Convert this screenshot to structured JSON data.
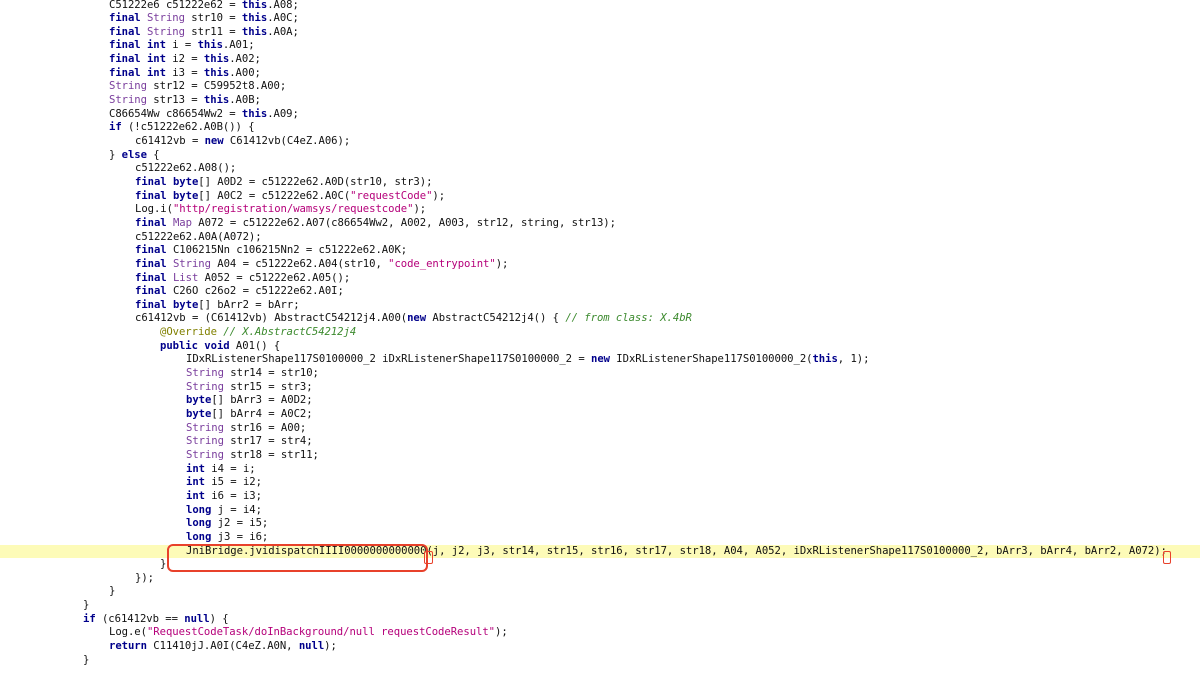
{
  "editor": {
    "highlight_color": "#fdfbb8",
    "annotation_color": "#e8412b",
    "token_colors": {
      "kw": "#00008b",
      "type": "#7a3e9d",
      "str": "#b5007a",
      "comment": "#3c8a2e",
      "annotation": "#808000"
    },
    "lines": [
      {
        "indent": 109,
        "tokens": [
          [
            "p",
            "C51222e6 c51222e62 = "
          ],
          [
            "k",
            "this"
          ],
          [
            "p",
            ".A08;"
          ]
        ]
      },
      {
        "indent": 109,
        "tokens": [
          [
            "k",
            "final "
          ],
          [
            "t",
            "String"
          ],
          [
            "p",
            " str10 = "
          ],
          [
            "k",
            "this"
          ],
          [
            "p",
            ".A0C;"
          ]
        ]
      },
      {
        "indent": 109,
        "tokens": [
          [
            "k",
            "final "
          ],
          [
            "t",
            "String"
          ],
          [
            "p",
            " str11 = "
          ],
          [
            "k",
            "this"
          ],
          [
            "p",
            ".A0A;"
          ]
        ]
      },
      {
        "indent": 109,
        "tokens": [
          [
            "k",
            "final int"
          ],
          [
            "p",
            " i = "
          ],
          [
            "k",
            "this"
          ],
          [
            "p",
            ".A01;"
          ]
        ]
      },
      {
        "indent": 109,
        "tokens": [
          [
            "k",
            "final int"
          ],
          [
            "p",
            " i2 = "
          ],
          [
            "k",
            "this"
          ],
          [
            "p",
            ".A02;"
          ]
        ]
      },
      {
        "indent": 109,
        "tokens": [
          [
            "k",
            "final int"
          ],
          [
            "p",
            " i3 = "
          ],
          [
            "k",
            "this"
          ],
          [
            "p",
            ".A00;"
          ]
        ]
      },
      {
        "indent": 109,
        "tokens": [
          [
            "t",
            "String"
          ],
          [
            "p",
            " str12 = C59952t8.A00;"
          ]
        ]
      },
      {
        "indent": 109,
        "tokens": [
          [
            "t",
            "String"
          ],
          [
            "p",
            " str13 = "
          ],
          [
            "k",
            "this"
          ],
          [
            "p",
            ".A0B;"
          ]
        ]
      },
      {
        "indent": 109,
        "tokens": [
          [
            "p",
            "C86654Ww c86654Ww2 = "
          ],
          [
            "k",
            "this"
          ],
          [
            "p",
            ".A09;"
          ]
        ]
      },
      {
        "indent": 109,
        "tokens": [
          [
            "k",
            "if"
          ],
          [
            "p",
            " (!c51222e62.A0B()) {"
          ]
        ]
      },
      {
        "indent": 135,
        "tokens": [
          [
            "p",
            "c61412vb = "
          ],
          [
            "k",
            "new"
          ],
          [
            "p",
            " C61412vb(C4eZ.A06);"
          ]
        ]
      },
      {
        "indent": 109,
        "tokens": [
          [
            "p",
            "} "
          ],
          [
            "k",
            "else"
          ],
          [
            "p",
            " {"
          ]
        ]
      },
      {
        "indent": 135,
        "tokens": [
          [
            "p",
            "c51222e62.A08();"
          ]
        ]
      },
      {
        "indent": 135,
        "tokens": [
          [
            "k",
            "final byte"
          ],
          [
            "p",
            "[] A0D2 = c51222e62.A0D(str10, str3);"
          ]
        ]
      },
      {
        "indent": 135,
        "tokens": [
          [
            "k",
            "final byte"
          ],
          [
            "p",
            "[] A0C2 = c51222e62.A0C("
          ],
          [
            "s",
            "\"requestCode\""
          ],
          [
            "p",
            ");"
          ]
        ]
      },
      {
        "indent": 135,
        "tokens": [
          [
            "p",
            "Log.i("
          ],
          [
            "s",
            "\"http/registration/wamsys/requestcode\""
          ],
          [
            "p",
            ");"
          ]
        ]
      },
      {
        "indent": 135,
        "tokens": [
          [
            "k",
            "final "
          ],
          [
            "t",
            "Map"
          ],
          [
            "p",
            " A072 = c51222e62.A07(c86654Ww2, A002, A003, str12, string, str13);"
          ]
        ]
      },
      {
        "indent": 135,
        "tokens": [
          [
            "p",
            "c51222e62.A0A(A072);"
          ]
        ]
      },
      {
        "indent": 135,
        "tokens": [
          [
            "k",
            "final"
          ],
          [
            "p",
            " C106215Nn c106215Nn2 = c51222e62.A0K;"
          ]
        ]
      },
      {
        "indent": 135,
        "tokens": [
          [
            "k",
            "final "
          ],
          [
            "t",
            "String"
          ],
          [
            "p",
            " A04 = c51222e62.A04(str10, "
          ],
          [
            "s",
            "\"code_entrypoint\""
          ],
          [
            "p",
            ");"
          ]
        ]
      },
      {
        "indent": 135,
        "tokens": [
          [
            "k",
            "final "
          ],
          [
            "t",
            "List"
          ],
          [
            "p",
            " A052 = c51222e62.A05();"
          ]
        ]
      },
      {
        "indent": 135,
        "tokens": [
          [
            "k",
            "final"
          ],
          [
            "p",
            " C26O c26o2 = c51222e62.A0I;"
          ]
        ]
      },
      {
        "indent": 135,
        "tokens": [
          [
            "k",
            "final byte"
          ],
          [
            "p",
            "[] bArr2 = bArr;"
          ]
        ]
      },
      {
        "indent": 135,
        "tokens": [
          [
            "p",
            "c61412vb = (C61412vb) AbstractC54212j4.A00("
          ],
          [
            "k",
            "new"
          ],
          [
            "p",
            " AbstractC54212j4() { "
          ],
          [
            "c",
            "// from class: X.4bR"
          ]
        ]
      },
      {
        "indent": 160,
        "tokens": [
          [
            "a",
            "@Override "
          ],
          [
            "c",
            "// X.AbstractC54212j4"
          ]
        ]
      },
      {
        "indent": 160,
        "tokens": [
          [
            "k",
            "public void"
          ],
          [
            "p",
            " A01() {"
          ]
        ]
      },
      {
        "indent": 186,
        "tokens": [
          [
            "p",
            "IDxRListenerShape117S0100000_2 iDxRListenerShape117S0100000_2 = "
          ],
          [
            "k",
            "new"
          ],
          [
            "p",
            " IDxRListenerShape117S0100000_2("
          ],
          [
            "k",
            "this"
          ],
          [
            "p",
            ", 1);"
          ]
        ]
      },
      {
        "indent": 186,
        "tokens": [
          [
            "t",
            "String"
          ],
          [
            "p",
            " str14 = str10;"
          ]
        ]
      },
      {
        "indent": 186,
        "tokens": [
          [
            "t",
            "String"
          ],
          [
            "p",
            " str15 = str3;"
          ]
        ]
      },
      {
        "indent": 186,
        "tokens": [
          [
            "k",
            "byte"
          ],
          [
            "p",
            "[] bArr3 = A0D2;"
          ]
        ]
      },
      {
        "indent": 186,
        "tokens": [
          [
            "k",
            "byte"
          ],
          [
            "p",
            "[] bArr4 = A0C2;"
          ]
        ]
      },
      {
        "indent": 186,
        "tokens": [
          [
            "t",
            "String"
          ],
          [
            "p",
            " str16 = A00;"
          ]
        ]
      },
      {
        "indent": 186,
        "tokens": [
          [
            "t",
            "String"
          ],
          [
            "p",
            " str17 = str4;"
          ]
        ]
      },
      {
        "indent": 186,
        "tokens": [
          [
            "t",
            "String"
          ],
          [
            "p",
            " str18 = str11;"
          ]
        ]
      },
      {
        "indent": 186,
        "tokens": [
          [
            "k",
            "int"
          ],
          [
            "p",
            " i4 = i;"
          ]
        ]
      },
      {
        "indent": 186,
        "tokens": [
          [
            "k",
            "int"
          ],
          [
            "p",
            " i5 = i2;"
          ]
        ]
      },
      {
        "indent": 186,
        "tokens": [
          [
            "k",
            "int"
          ],
          [
            "p",
            " i6 = i3;"
          ]
        ]
      },
      {
        "indent": 186,
        "tokens": [
          [
            "k",
            "long"
          ],
          [
            "p",
            " j = i4;"
          ]
        ]
      },
      {
        "indent": 186,
        "tokens": [
          [
            "k",
            "long"
          ],
          [
            "p",
            " j2 = i5;"
          ]
        ]
      },
      {
        "indent": 186,
        "tokens": [
          [
            "k",
            "long"
          ],
          [
            "p",
            " j3 = i6;"
          ]
        ]
      },
      {
        "indent": 186,
        "highlight": true,
        "tokens": [
          [
            "p",
            "JniBridge.jvidispatchIIII0000000000000("
          ],
          [
            "p",
            "j, j2, j3, str14, str15, str16, str17, str18, A04, A052, iDxRListenerShape117S0100000_2, bArr3, bArr4, bArr2, A072"
          ],
          [
            "p",
            ");"
          ]
        ]
      },
      {
        "indent": 160,
        "tokens": [
          [
            "p",
            "}"
          ]
        ]
      },
      {
        "indent": 135,
        "tokens": [
          [
            "p",
            "});"
          ]
        ]
      },
      {
        "indent": 109,
        "tokens": [
          [
            "p",
            "}"
          ]
        ]
      },
      {
        "indent": 83,
        "tokens": [
          [
            "p",
            "}"
          ]
        ]
      },
      {
        "indent": 83,
        "tokens": [
          [
            "k",
            "if"
          ],
          [
            "p",
            " (c61412vb == "
          ],
          [
            "k",
            "null"
          ],
          [
            "p",
            ") {"
          ]
        ]
      },
      {
        "indent": 109,
        "tokens": [
          [
            "p",
            "Log.e("
          ],
          [
            "s",
            "\"RequestCodeTask/doInBackground/null requestCodeResult\""
          ],
          [
            "p",
            ");"
          ]
        ]
      },
      {
        "indent": 109,
        "tokens": [
          [
            "k",
            "return"
          ],
          [
            "p",
            " C11410jJ.A0I(C4eZ.A0N, "
          ],
          [
            "k",
            "null"
          ],
          [
            "p",
            ");"
          ]
        ]
      },
      {
        "indent": 83,
        "tokens": [
          [
            "p",
            "}"
          ]
        ]
      }
    ]
  }
}
